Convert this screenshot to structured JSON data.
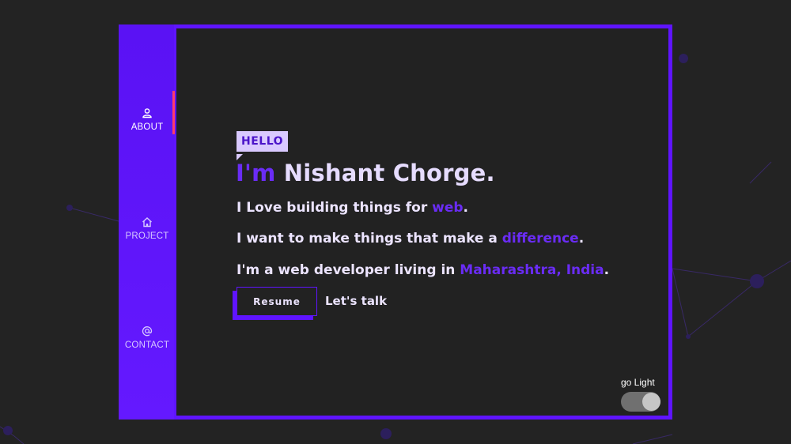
{
  "nav": {
    "items": [
      {
        "label": "ABOUT",
        "icon": "user-icon",
        "active": true
      },
      {
        "label": "PROJECT",
        "icon": "home-icon",
        "active": false
      },
      {
        "label": "CONTACT",
        "icon": "at-icon",
        "active": false
      }
    ]
  },
  "hero": {
    "badge": "HELLO",
    "heading_prefix": "I'm",
    "heading_name": "Nishant Chorge.",
    "line1_text": "I Love building things for ",
    "line1_accent": "web",
    "line1_end": ".",
    "line2_text": "I want to make things that make a ",
    "line2_accent": "difference",
    "line2_end": ".",
    "line3_text": "I'm a web developer living in ",
    "line3_accent": "Maharashtra, India",
    "line3_end": "."
  },
  "actions": {
    "resume_label": "Resume",
    "talk_label": "Let's talk"
  },
  "theme_toggle": {
    "label": "go Light",
    "state": "dark"
  },
  "colors": {
    "accent": "#5f14ff",
    "accent_text": "#6a2cf5",
    "background": "#232323",
    "panel": "#222222",
    "active_indicator": "#ff3b6b",
    "badge_bg": "#d9c9ff"
  }
}
